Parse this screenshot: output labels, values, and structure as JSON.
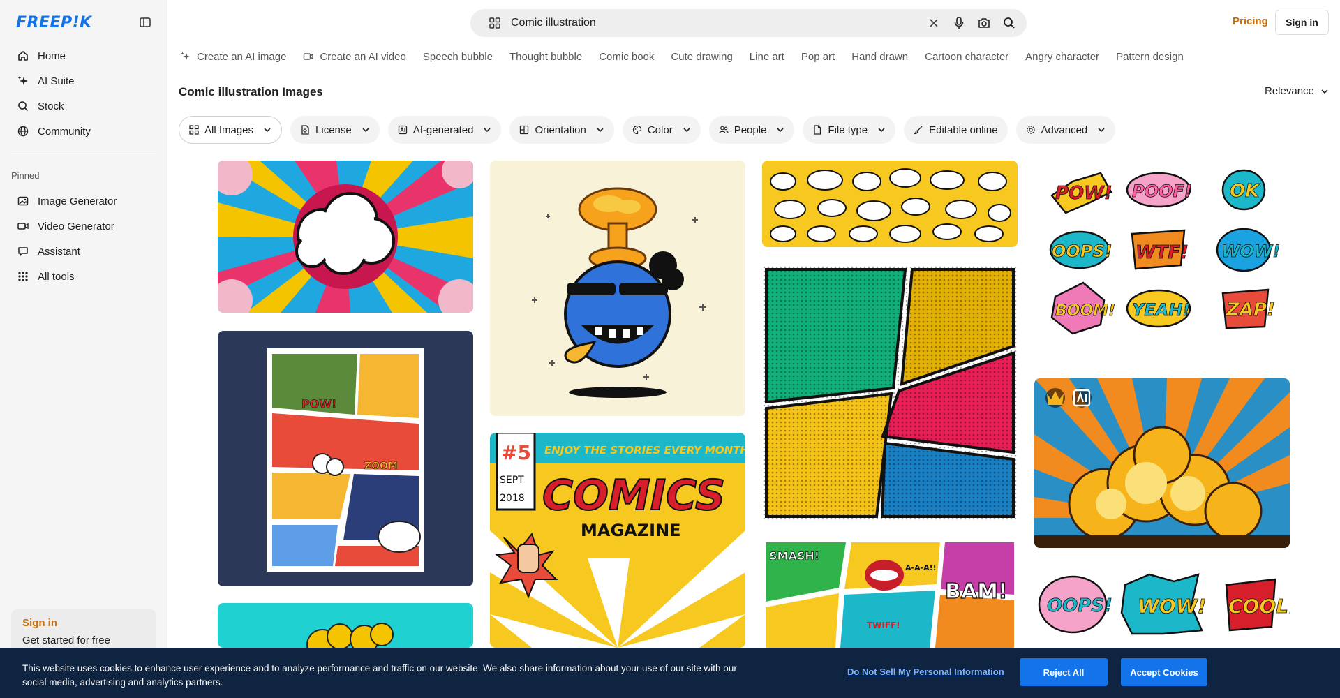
{
  "brand": {
    "logo_text": "FREEP!K",
    "color": "#1273eb"
  },
  "sidebar": {
    "nav": [
      {
        "label": "Home",
        "icon": "home-icon"
      },
      {
        "label": "AI Suite",
        "icon": "sparkle-icon"
      },
      {
        "label": "Stock",
        "icon": "search-icon"
      },
      {
        "label": "Community",
        "icon": "globe-icon"
      }
    ],
    "pinned_label": "Pinned",
    "pinned": [
      {
        "label": "Image Generator",
        "icon": "image-icon"
      },
      {
        "label": "Video Generator",
        "icon": "video-icon"
      },
      {
        "label": "Assistant",
        "icon": "chat-icon"
      },
      {
        "label": "All tools",
        "icon": "grid-icon"
      }
    ],
    "signin_card": {
      "title": "Sign in",
      "subtitle": "Get started for free"
    }
  },
  "header": {
    "search_value": "Comic illustration",
    "pricing": "Pricing",
    "signin": "Sign in"
  },
  "suggestions": [
    {
      "label": "Create an AI image",
      "icon": "sparkle-icon"
    },
    {
      "label": "Create an AI video",
      "icon": "video-icon"
    },
    {
      "label": "Speech bubble"
    },
    {
      "label": "Thought bubble"
    },
    {
      "label": "Comic book"
    },
    {
      "label": "Cute drawing"
    },
    {
      "label": "Line art"
    },
    {
      "label": "Pop art"
    },
    {
      "label": "Hand drawn"
    },
    {
      "label": "Cartoon character"
    },
    {
      "label": "Angry character"
    },
    {
      "label": "Pattern design"
    }
  ],
  "results": {
    "title": "Comic illustration Images",
    "sort": "Relevance"
  },
  "filters": [
    {
      "label": "All Images",
      "icon": "grid-icon",
      "chevron": true
    },
    {
      "label": "License",
      "icon": "license-icon",
      "chevron": true
    },
    {
      "label": "AI-generated",
      "icon": "ai-icon",
      "chevron": true
    },
    {
      "label": "Orientation",
      "icon": "orientation-icon",
      "chevron": true
    },
    {
      "label": "Color",
      "icon": "palette-icon",
      "chevron": true
    },
    {
      "label": "People",
      "icon": "people-icon",
      "chevron": true
    },
    {
      "label": "File type",
      "icon": "file-icon",
      "chevron": true
    },
    {
      "label": "Editable online",
      "icon": "brush-icon",
      "chevron": false
    },
    {
      "label": "Advanced",
      "icon": "gear-icon",
      "chevron": true
    }
  ],
  "images": {
    "pow": [
      "POW!",
      "POOF!",
      "OK",
      "OOPS!",
      "WTF!",
      "WOW!",
      "BOOM!",
      "YEAH!",
      "ZAP!"
    ],
    "pow2": [
      "OOPS!",
      "WOW!",
      "COOL!"
    ],
    "magazine": {
      "number": "#5",
      "month": "SEPT",
      "year": "2018",
      "tagline": "ENJOY THE STORIES EVERY MONTH",
      "title": "COMICS",
      "subtitle": "MAGAZINE"
    },
    "page_words": [
      "POW!",
      "ZOOM"
    ],
    "strip_words": [
      "SMASH!",
      "A-A-A!!",
      "BAM!",
      "TWIFF!"
    ]
  },
  "cookie": {
    "message": "This website uses cookies to enhance user experience and to analyze performance and traffic on our website. We also share information about your use of our site with our social media, advertising and analytics partners.",
    "dns": "Do Not Sell My Personal Information",
    "reject": "Reject All",
    "accept": "Accept Cookies"
  },
  "colors": {
    "accent": "#1273eb",
    "pricing": "#c9710c",
    "cookie_bg": "#0f2440"
  }
}
